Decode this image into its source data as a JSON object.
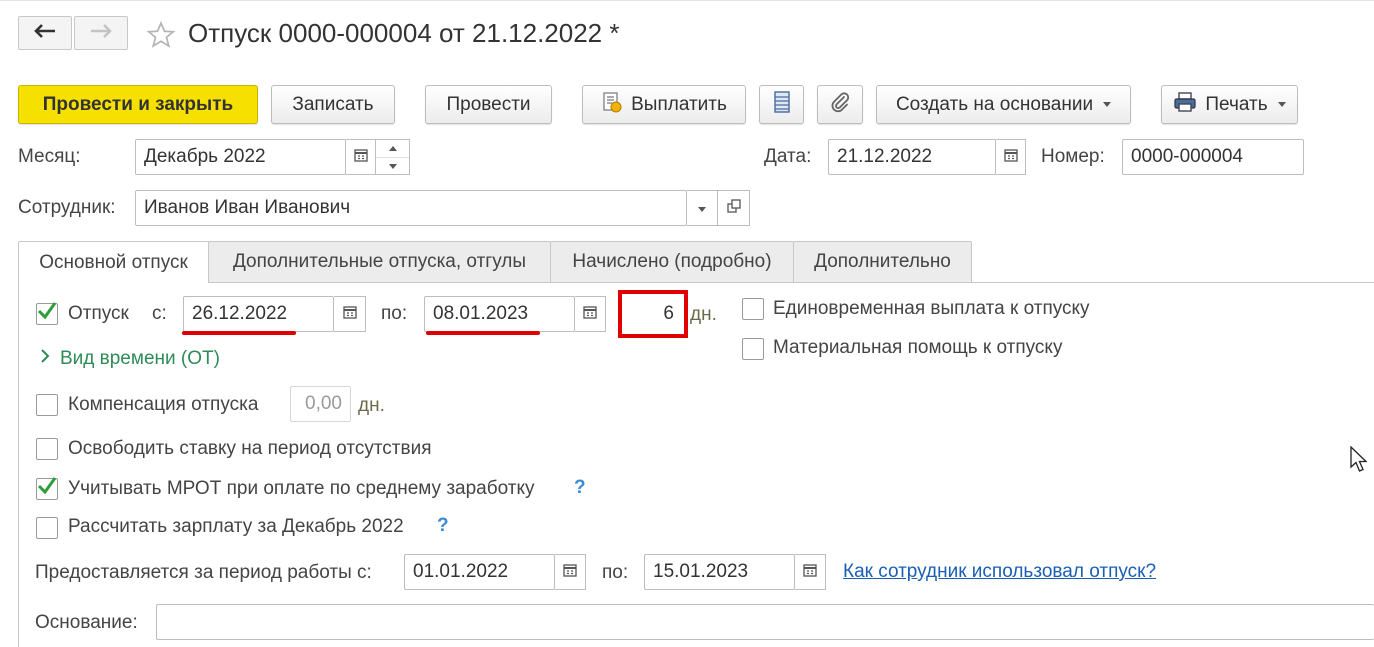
{
  "window": {
    "title": "Отпуск 0000-000004 от 21.12.2022 *"
  },
  "toolbar": {
    "post_close": "Провести и закрыть",
    "save": "Записать",
    "post": "Провести",
    "pay": "Выплатить",
    "create_based": "Создать на основании",
    "print": "Печать"
  },
  "header": {
    "month_label": "Месяц:",
    "month_value": "Декабрь 2022",
    "date_label": "Дата:",
    "date_value": "21.12.2022",
    "number_label": "Номер:",
    "number_value": "0000-000004",
    "employee_label": "Сотрудник:",
    "employee_value": "Иванов Иван Иванович"
  },
  "tabs": [
    {
      "label": "Основной отпуск",
      "active": true
    },
    {
      "label": "Дополнительные отпуска, отгулы",
      "active": false
    },
    {
      "label": "Начислено (подробно)",
      "active": false
    },
    {
      "label": "Дополнительно",
      "active": false
    }
  ],
  "main": {
    "vacation_label": "Отпуск",
    "vacation_checked": true,
    "from_label": "с:",
    "from_value": "26.12.2022",
    "to_label": "по:",
    "to_value": "08.01.2023",
    "days_value": "6",
    "days_unit": "дн.",
    "time_kind": "Вид времени (ОТ)",
    "one_time_payment": "Единовременная выплата к отпуску",
    "material_help": "Материальная помощь к отпуску",
    "compensation_label": "Компенсация отпуска",
    "compensation_value": "0,00",
    "compensation_unit": "дн.",
    "free_rate": "Освободить ставку на период отсутствия",
    "mrot_label": "Учитывать МРОТ при оплате по среднему заработку",
    "mrot_checked": true,
    "calc_salary": "Рассчитать зарплату за Декабрь 2022",
    "help_mark": "?",
    "period_label": "Предоставляется за период работы с:",
    "period_from": "01.01.2022",
    "period_to_label": "по:",
    "period_to": "15.01.2023",
    "usage_link": "Как сотрудник использовал отпуск?",
    "basis_label": "Основание:",
    "basis_value": ""
  },
  "colors": {
    "primary_button": "#f6e000",
    "check_mark": "#2e9e3a",
    "link": "#1a5fb4",
    "highlight": "#e00000",
    "time_kind_link": "#2e8b57"
  }
}
